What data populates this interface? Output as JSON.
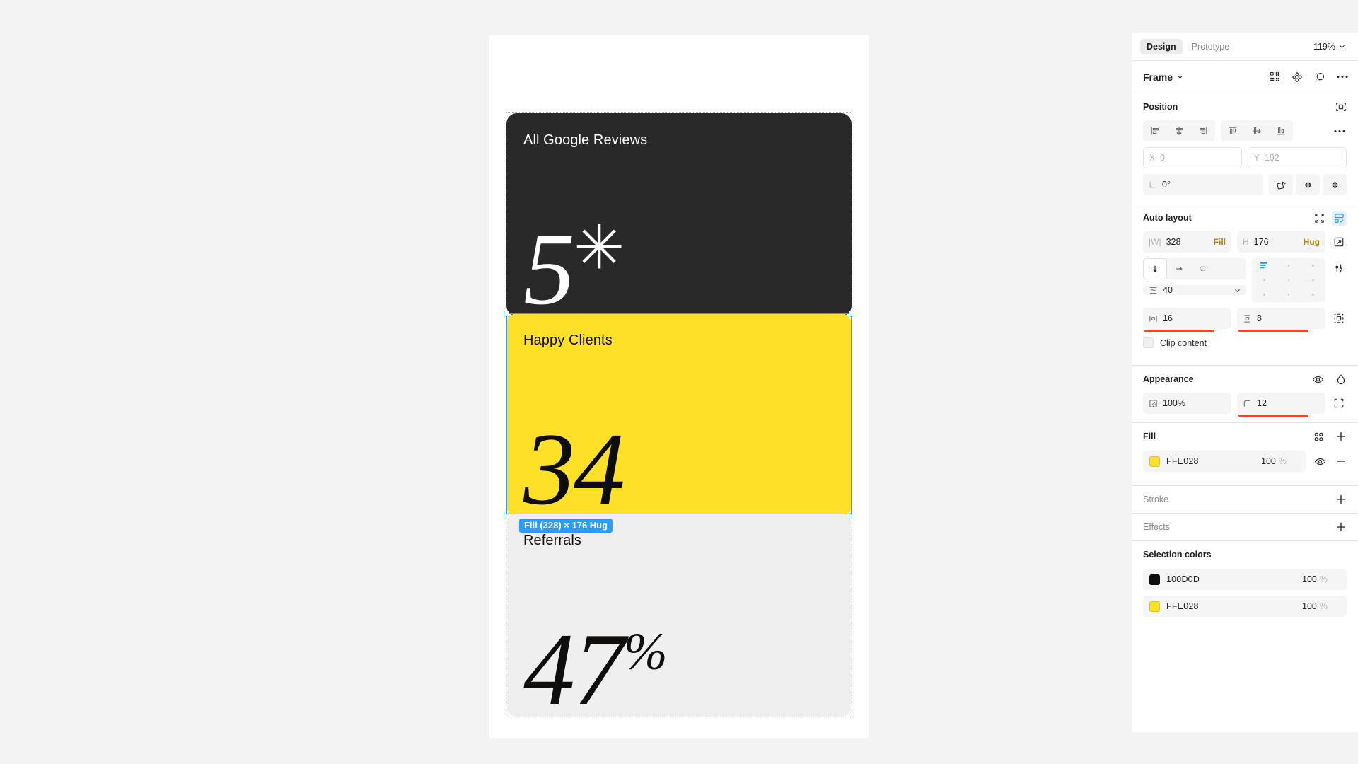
{
  "app": {
    "name": "Figma",
    "canvas_bg": "#f3f3f3"
  },
  "panel": {
    "tabs": [
      {
        "label": "Design",
        "active": true
      },
      {
        "label": "Prototype",
        "active": false
      }
    ],
    "zoom": {
      "value": "119%",
      "chevron": "chevron-down-icon"
    },
    "object": {
      "type": "Frame",
      "chevron": "chevron-down-icon",
      "icons": [
        "component-icon",
        "boolean-union-icon",
        "mask-icon",
        "more-options-icon"
      ]
    },
    "position": {
      "title": "Position",
      "align_icons": [
        "align-left-icon",
        "align-horizontal-center-icon",
        "align-right-icon",
        "align-top-icon",
        "align-vertical-center-icon",
        "align-bottom-icon",
        "more-align-options-icon"
      ],
      "x_label": "X",
      "x_value": "0",
      "y_label": "Y",
      "y_value": "192",
      "rotation_label": "angle-icon",
      "rotation_value": "0°",
      "transform_icons": [
        "rotate-icon",
        "flip-horizontal-icon",
        "flip-vertical-icon"
      ],
      "absolute_position_icon": "absolute-position-icon"
    },
    "autolayout": {
      "title": "Auto layout",
      "collapse_icon": "collapse-icon",
      "settings_icon": "autolayout-settings-icon",
      "width_label": "|W|",
      "width_value": "328",
      "width_mode": "Fill",
      "height_label": "H",
      "height_value": "176",
      "height_mode": "Hug",
      "resize_icon": "resize-icon",
      "direction_icons": [
        "direction-vertical-icon",
        "direction-horizontal-icon",
        "direction-wrap-icon"
      ],
      "direction_selected": 0,
      "gap_icon": "gap-icon",
      "gap_value": "40",
      "gap_chevron": "chevron-down-icon",
      "advanced_icon": "advanced-layout-icon",
      "padding_h_icon": "horizontal-padding-icon",
      "padding_h_value": "16",
      "padding_v_icon": "vertical-padding-icon",
      "padding_v_value": "8",
      "padding_all_icon": "individual-padding-icon",
      "clip_content_label": "Clip content",
      "clip_content_checked": false
    },
    "appearance": {
      "title": "Appearance",
      "visibility_icon": "eye-icon",
      "blend_icon": "blend-mode-icon",
      "opacity_icon": "opacity-icon",
      "opacity_value": "100%",
      "corner_icon": "corner-radius-icon",
      "corner_value": "12",
      "independent_corners_icon": "independent-corners-icon"
    },
    "fill": {
      "title": "Fill",
      "styles_icon": "color-styles-icon",
      "add_icon": "plus-icon",
      "items": [
        {
          "swatch": "#FFE028",
          "hex": "FFE028",
          "opacity": "100",
          "unit": "%",
          "visibility_icon": "eye-icon",
          "remove_icon": "minus-icon"
        }
      ]
    },
    "stroke": {
      "title": "Stroke",
      "add_icon": "plus-icon"
    },
    "effects": {
      "title": "Effects",
      "add_icon": "plus-icon"
    },
    "selection_colors": {
      "title": "Selection colors",
      "items": [
        {
          "swatch": "#100D0D",
          "hex": "100D0D",
          "opacity": "100",
          "unit": "%"
        },
        {
          "swatch": "#FFE028",
          "hex": "FFE028",
          "opacity": "100",
          "unit": "%"
        }
      ]
    }
  },
  "canvas": {
    "selection_badge": "Fill (328) × 176 Hug",
    "cards": [
      {
        "id": "reviews",
        "title": "All Google Reviews",
        "value": "5",
        "suffix": "",
        "star": "✳",
        "bg": "#292929",
        "fg": "#ffffff"
      },
      {
        "id": "clients",
        "title": "Happy Clients",
        "value": "34",
        "suffix": "",
        "star": "",
        "bg": "#FFE028",
        "fg": "#0d0d0d"
      },
      {
        "id": "referrals",
        "title": "Referrals",
        "value": "47",
        "suffix": "%",
        "star": "",
        "bg": "#EFEFEF",
        "fg": "#100D0D"
      }
    ]
  }
}
